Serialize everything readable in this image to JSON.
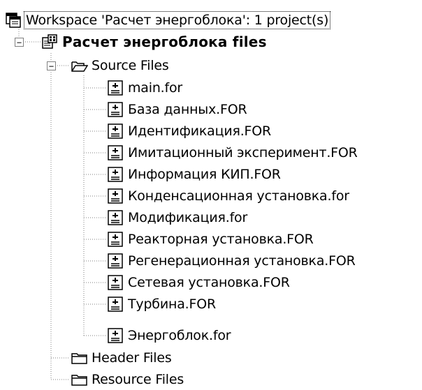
{
  "workspace": {
    "label": "Workspace 'Расчет энергоблока': 1 project(s)"
  },
  "project": {
    "label": "Расчет энергоблока files",
    "expander": "−"
  },
  "folders": [
    {
      "label": "Source Files",
      "expander": "−",
      "expanded": true,
      "files": [
        "main.for",
        "База данных.FOR",
        "Идентификация.FOR",
        "Имитационный эксперимент.FOR",
        "Информация КИП.FOR",
        "Конденсационная установка.for",
        "Модификация.for",
        "Реакторная установка.FOR",
        "Регенерационная установка.FOR",
        "Сетевая установка.FOR",
        "Турбина.FOR",
        "Энергоблок.for"
      ]
    },
    {
      "label": "Header Files",
      "expanded": false,
      "files": []
    },
    {
      "label": "Resource Files",
      "expanded": false,
      "files": []
    }
  ],
  "icons": {
    "workspace": "workspace-icon",
    "project": "project-icon",
    "folder_open": "open-folder-icon",
    "folder_closed": "folder-icon",
    "file": "source-file-icon"
  },
  "colors": {
    "tree_line": "#808080",
    "text": "#000000",
    "background": "#ffffff"
  }
}
